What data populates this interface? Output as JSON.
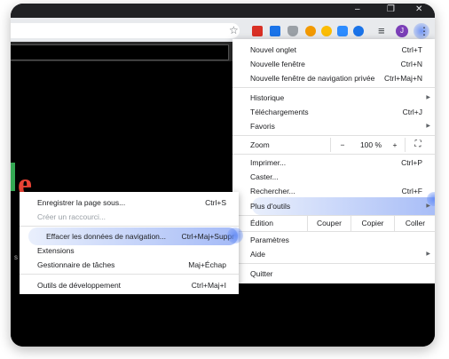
{
  "window": {
    "minimize": "‒",
    "restore": "❐",
    "close": "✕"
  },
  "toolbar": {
    "star_icon": "☆",
    "extensions": [
      "ext-red-icon",
      "ext-blue-icon",
      "ext-shield-icon",
      "ext-orange-icon",
      "ext-yellow-icon",
      "ext-zoom-icon",
      "ext-play-icon"
    ],
    "media_icon": "≡",
    "profile_initial": "J",
    "menu_icon": "⋮",
    "colors": {
      "profile": "#7b3fb8",
      "highlight": "#6e8ff0"
    }
  },
  "page": {
    "logo_letter": "e",
    "side_text": "s"
  },
  "main_menu": {
    "new_tab": {
      "label": "Nouvel onglet",
      "shortcut": "Ctrl+T"
    },
    "new_window": {
      "label": "Nouvelle fenêtre",
      "shortcut": "Ctrl+N"
    },
    "new_incognito": {
      "label": "Nouvelle fenêtre de navigation privée",
      "shortcut": "Ctrl+Maj+N"
    },
    "history": {
      "label": "Historique"
    },
    "downloads": {
      "label": "Téléchargements",
      "shortcut": "Ctrl+J"
    },
    "bookmarks": {
      "label": "Favoris"
    },
    "zoom": {
      "label": "Zoom",
      "minus": "−",
      "value": "100 %",
      "plus": "+",
      "fullscreen": "⛶"
    },
    "print": {
      "label": "Imprimer...",
      "shortcut": "Ctrl+P"
    },
    "cast": {
      "label": "Caster..."
    },
    "find": {
      "label": "Rechercher...",
      "shortcut": "Ctrl+F"
    },
    "more_tools": {
      "label": "Plus d'outils"
    },
    "edit": {
      "label": "Édition",
      "cut": "Couper",
      "copy": "Copier",
      "paste": "Coller"
    },
    "settings": {
      "label": "Paramètres"
    },
    "help": {
      "label": "Aide"
    },
    "quit": {
      "label": "Quitter"
    },
    "submenu_arrow": "▶"
  },
  "submenu": {
    "save_page": {
      "label": "Enregistrer la page sous...",
      "shortcut": "Ctrl+S"
    },
    "create_shortcut": {
      "label": "Créer un raccourci..."
    },
    "clear_data": {
      "label": "Effacer les données de navigation...",
      "shortcut": "Ctrl+Maj+Suppr"
    },
    "extensions": {
      "label": "Extensions"
    },
    "task_manager": {
      "label": "Gestionnaire de tâches",
      "shortcut": "Maj+Échap"
    },
    "dev_tools": {
      "label": "Outils de développement",
      "shortcut": "Ctrl+Maj+I"
    }
  }
}
